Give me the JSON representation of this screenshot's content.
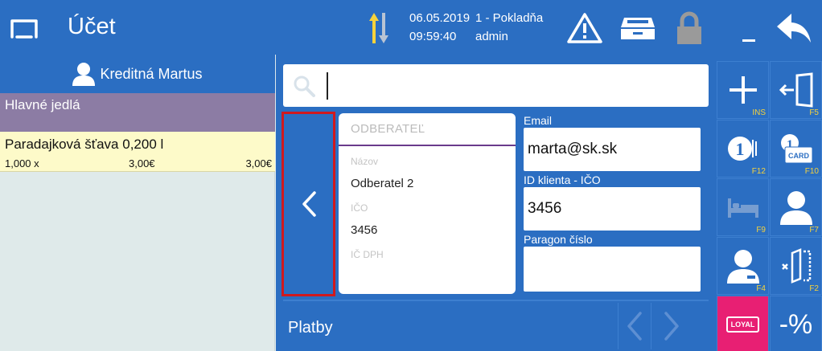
{
  "header": {
    "title": "Účet",
    "date": "06.05.2019",
    "time": "09:59:40",
    "register": "1 - Pokladňa",
    "user": "admin",
    "icons": [
      "app-icon",
      "sort-icon",
      "warning-icon",
      "cash-drawer-icon",
      "lock-icon",
      "minimize-icon",
      "back-icon"
    ]
  },
  "left_panel": {
    "customer": "Kreditná Martus",
    "category": "Hlavné jedlá",
    "items": [
      {
        "name": "Paradajková šťava 0,200 l",
        "qty": "1,000 x",
        "unit_price": "3,00€",
        "total": "3,00€"
      }
    ]
  },
  "center": {
    "search": {
      "value": "",
      "placeholder": ""
    },
    "buyer": {
      "title": "ODBERATEĽ",
      "name_label": "Názov",
      "name_value": "Odberatel 2",
      "ico_label": "IČO",
      "ico_value": "3456",
      "dic_label": "IČ DPH",
      "dic_value": ""
    },
    "email_label": "Email",
    "email_value": "marta@sk.sk",
    "client_id_label": "ID klienta - IČO",
    "client_id_value": "3456",
    "receipt_label": "Paragon číslo",
    "receipt_value": "",
    "payments_label": "Platby"
  },
  "side_buttons": {
    "keys": [
      "INS",
      "F5",
      "F12",
      "F10",
      "F9",
      "F7",
      "F4",
      "F2"
    ],
    "card_text": "CARD",
    "loyal_text": "LOYAL",
    "discount_text": "-%"
  },
  "colors": {
    "primary": "#2b6ec2",
    "category": "#8c7ca4",
    "item_bg": "#fdfac9",
    "highlight": "#d0191e",
    "loyal": "#e81f73",
    "key_label": "#f5d23c"
  }
}
